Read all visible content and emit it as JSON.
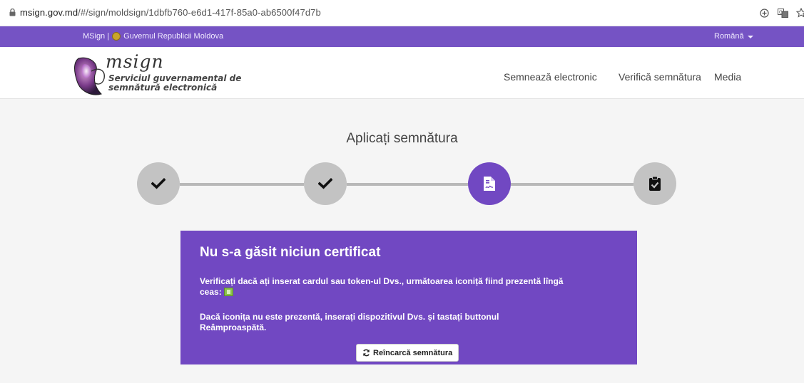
{
  "browser": {
    "url_host": "msign.gov.md",
    "url_path": "/#/sign/moldsign/1dbfb760-e6d1-417f-85a0-ab6500f47d7b",
    "icons": [
      "lock-icon",
      "add-circle-icon",
      "translate-icon",
      "star-icon"
    ]
  },
  "topbar": {
    "site": "MSign | ",
    "gov": "Guvernul Republicii Moldova",
    "language": "Română"
  },
  "header": {
    "logo_text": "msign",
    "tagline_line1": "Serviciul guvernamental de",
    "tagline_line2": "semnătură electronică",
    "nav": [
      "Semnează electronic",
      "Verifică semnătura",
      "Media"
    ]
  },
  "main": {
    "title": "Aplicați semnătura",
    "steps": [
      {
        "icon": "check-icon",
        "state": "done"
      },
      {
        "icon": "check-icon",
        "state": "done"
      },
      {
        "icon": "signed-document-icon",
        "state": "active"
      },
      {
        "icon": "clipboard-check-icon",
        "state": "pending"
      }
    ]
  },
  "panel": {
    "title": "Nu s-a găsit niciun certificat",
    "p1_line1": "Verificați dacă ați inserat cardul sau token-ul Dvs., următoarea iconiță fiind prezentă lîngă",
    "p1_line2": "ceas:",
    "p2_line1": "Dacă iconița nu este prezentă, inserați dispozitivul Dvs. și tastați buttonul",
    "p2_line2": "Reâmproaspătă.",
    "button": "Reîncarcă semnătura"
  },
  "colors": {
    "brand_purple": "#7148c2",
    "topstrip_purple": "#7553c4",
    "step_gray": "#c3c3c3"
  }
}
